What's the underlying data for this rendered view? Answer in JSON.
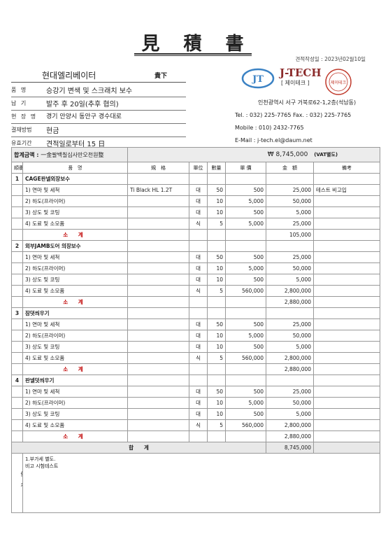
{
  "title": "見　積　書",
  "date": "견적작성일 : 2023년02월10일",
  "client": {
    "name": "현대엘리베이터",
    "suffix": "貴下"
  },
  "info": [
    {
      "label": "품 명",
      "value": "승강기 변색 및 스크래치 보수"
    },
    {
      "label": "납 기",
      "value": "발주 후 20일(추후 협의)"
    },
    {
      "label": "현 장 명",
      "value": "경기 안양시 동안구 경수대로"
    },
    {
      "label": "결재방법",
      "value": "현금"
    },
    {
      "label": "유효기간",
      "value": "견적일로부터 15 日"
    }
  ],
  "company": {
    "logo_text": "JT",
    "brand": "J-TECH",
    "brand_sub": "[ 제이테크 ]",
    "seal_text": "제이테크",
    "address": "인천광역시 서구 거북로62-1,2층(석남동)",
    "tel_fax": "Tel. :  032)  225-7765   Fax. :  032)  225-7765",
    "mobile": "Mobile : 010) 2432-7765",
    "email": "E-Mail : j-tech.el@daum.net"
  },
  "amount": {
    "label": "합계금액 :",
    "korean": "一金팔백칠십사만오천원整",
    "value": "₩ 8,745,000",
    "vat": "(VAT별도)"
  },
  "columns": [
    "順番",
    "품　명",
    "規　格",
    "單位",
    "數量",
    "單 價",
    "金　額",
    "備考"
  ],
  "groups": [
    {
      "no": "1",
      "name": "CAGE판넬외장보수",
      "items": [
        {
          "name": "1) 연마 및 세척",
          "spec": "Ti Black HL 1.2T",
          "unit": "대",
          "qty": "50",
          "price": "500",
          "amount": "25,000",
          "note": "테스트 비고입"
        },
        {
          "name": "2) 하도(프라이머)",
          "spec": "",
          "unit": "대",
          "qty": "10",
          "price": "5,000",
          "amount": "50,000",
          "note": ""
        },
        {
          "name": "3) 상도 및 코팅",
          "spec": "",
          "unit": "대",
          "qty": "10",
          "price": "500",
          "amount": "5,000",
          "note": ""
        },
        {
          "name": "4) 도료 및 소모품",
          "spec": "",
          "unit": "식",
          "qty": "5",
          "price": "5,000",
          "amount": "25,000",
          "note": ""
        }
      ],
      "subtotal_label": "소 계",
      "subtotal": "105,000"
    },
    {
      "no": "2",
      "name": "외부JAMB도어 의장보수",
      "items": [
        {
          "name": "1) 연마 및 세척",
          "spec": "",
          "unit": "대",
          "qty": "50",
          "price": "500",
          "amount": "25,000",
          "note": ""
        },
        {
          "name": "2) 하도(프라이머)",
          "spec": "",
          "unit": "대",
          "qty": "10",
          "price": "5,000",
          "amount": "50,000",
          "note": ""
        },
        {
          "name": "3) 상도 및 코팅",
          "spec": "",
          "unit": "대",
          "qty": "10",
          "price": "500",
          "amount": "5,000",
          "note": ""
        },
        {
          "name": "4) 도료 및 소모품",
          "spec": "",
          "unit": "식",
          "qty": "5",
          "price": "560,000",
          "amount": "2,800,000",
          "note": ""
        }
      ],
      "subtotal_label": "소 계",
      "subtotal": "2,880,000"
    },
    {
      "no": "3",
      "name": "잠뎟씌우기",
      "items": [
        {
          "name": "1) 연마 및 세척",
          "spec": "",
          "unit": "대",
          "qty": "50",
          "price": "500",
          "amount": "25,000",
          "note": ""
        },
        {
          "name": "2) 하도(프라이머)",
          "spec": "",
          "unit": "대",
          "qty": "10",
          "price": "5,000",
          "amount": "50,000",
          "note": ""
        },
        {
          "name": "3) 상도 및 코팅",
          "spec": "",
          "unit": "대",
          "qty": "10",
          "price": "500",
          "amount": "5,000",
          "note": ""
        },
        {
          "name": "4) 도료 및 소모품",
          "spec": "",
          "unit": "식",
          "qty": "5",
          "price": "560,000",
          "amount": "2,800,000",
          "note": ""
        }
      ],
      "subtotal_label": "소 계",
      "subtotal": "2,880,000"
    },
    {
      "no": "4",
      "name": "판넬덧씌우기",
      "items": [
        {
          "name": "1) 연마 및 세척",
          "spec": "",
          "unit": "대",
          "qty": "50",
          "price": "500",
          "amount": "25,000",
          "note": ""
        },
        {
          "name": "2) 하도(프라이머)",
          "spec": "",
          "unit": "대",
          "qty": "10",
          "price": "5,000",
          "amount": "50,000",
          "note": ""
        },
        {
          "name": "3) 상도 및 코팅",
          "spec": "",
          "unit": "대",
          "qty": "10",
          "price": "500",
          "amount": "5,000",
          "note": ""
        },
        {
          "name": "4) 도료 및 소모품",
          "spec": "",
          "unit": "식",
          "qty": "5",
          "price": "560,000",
          "amount": "2,800,000",
          "note": ""
        }
      ],
      "subtotal_label": "소 계",
      "subtotal": "2,880,000"
    }
  ],
  "total": {
    "label": "합　　계",
    "value": "8,745,000"
  },
  "notes": {
    "label": "備　考",
    "lines": [
      "1.부가세 별도.",
      "비고 시험테스트"
    ]
  }
}
